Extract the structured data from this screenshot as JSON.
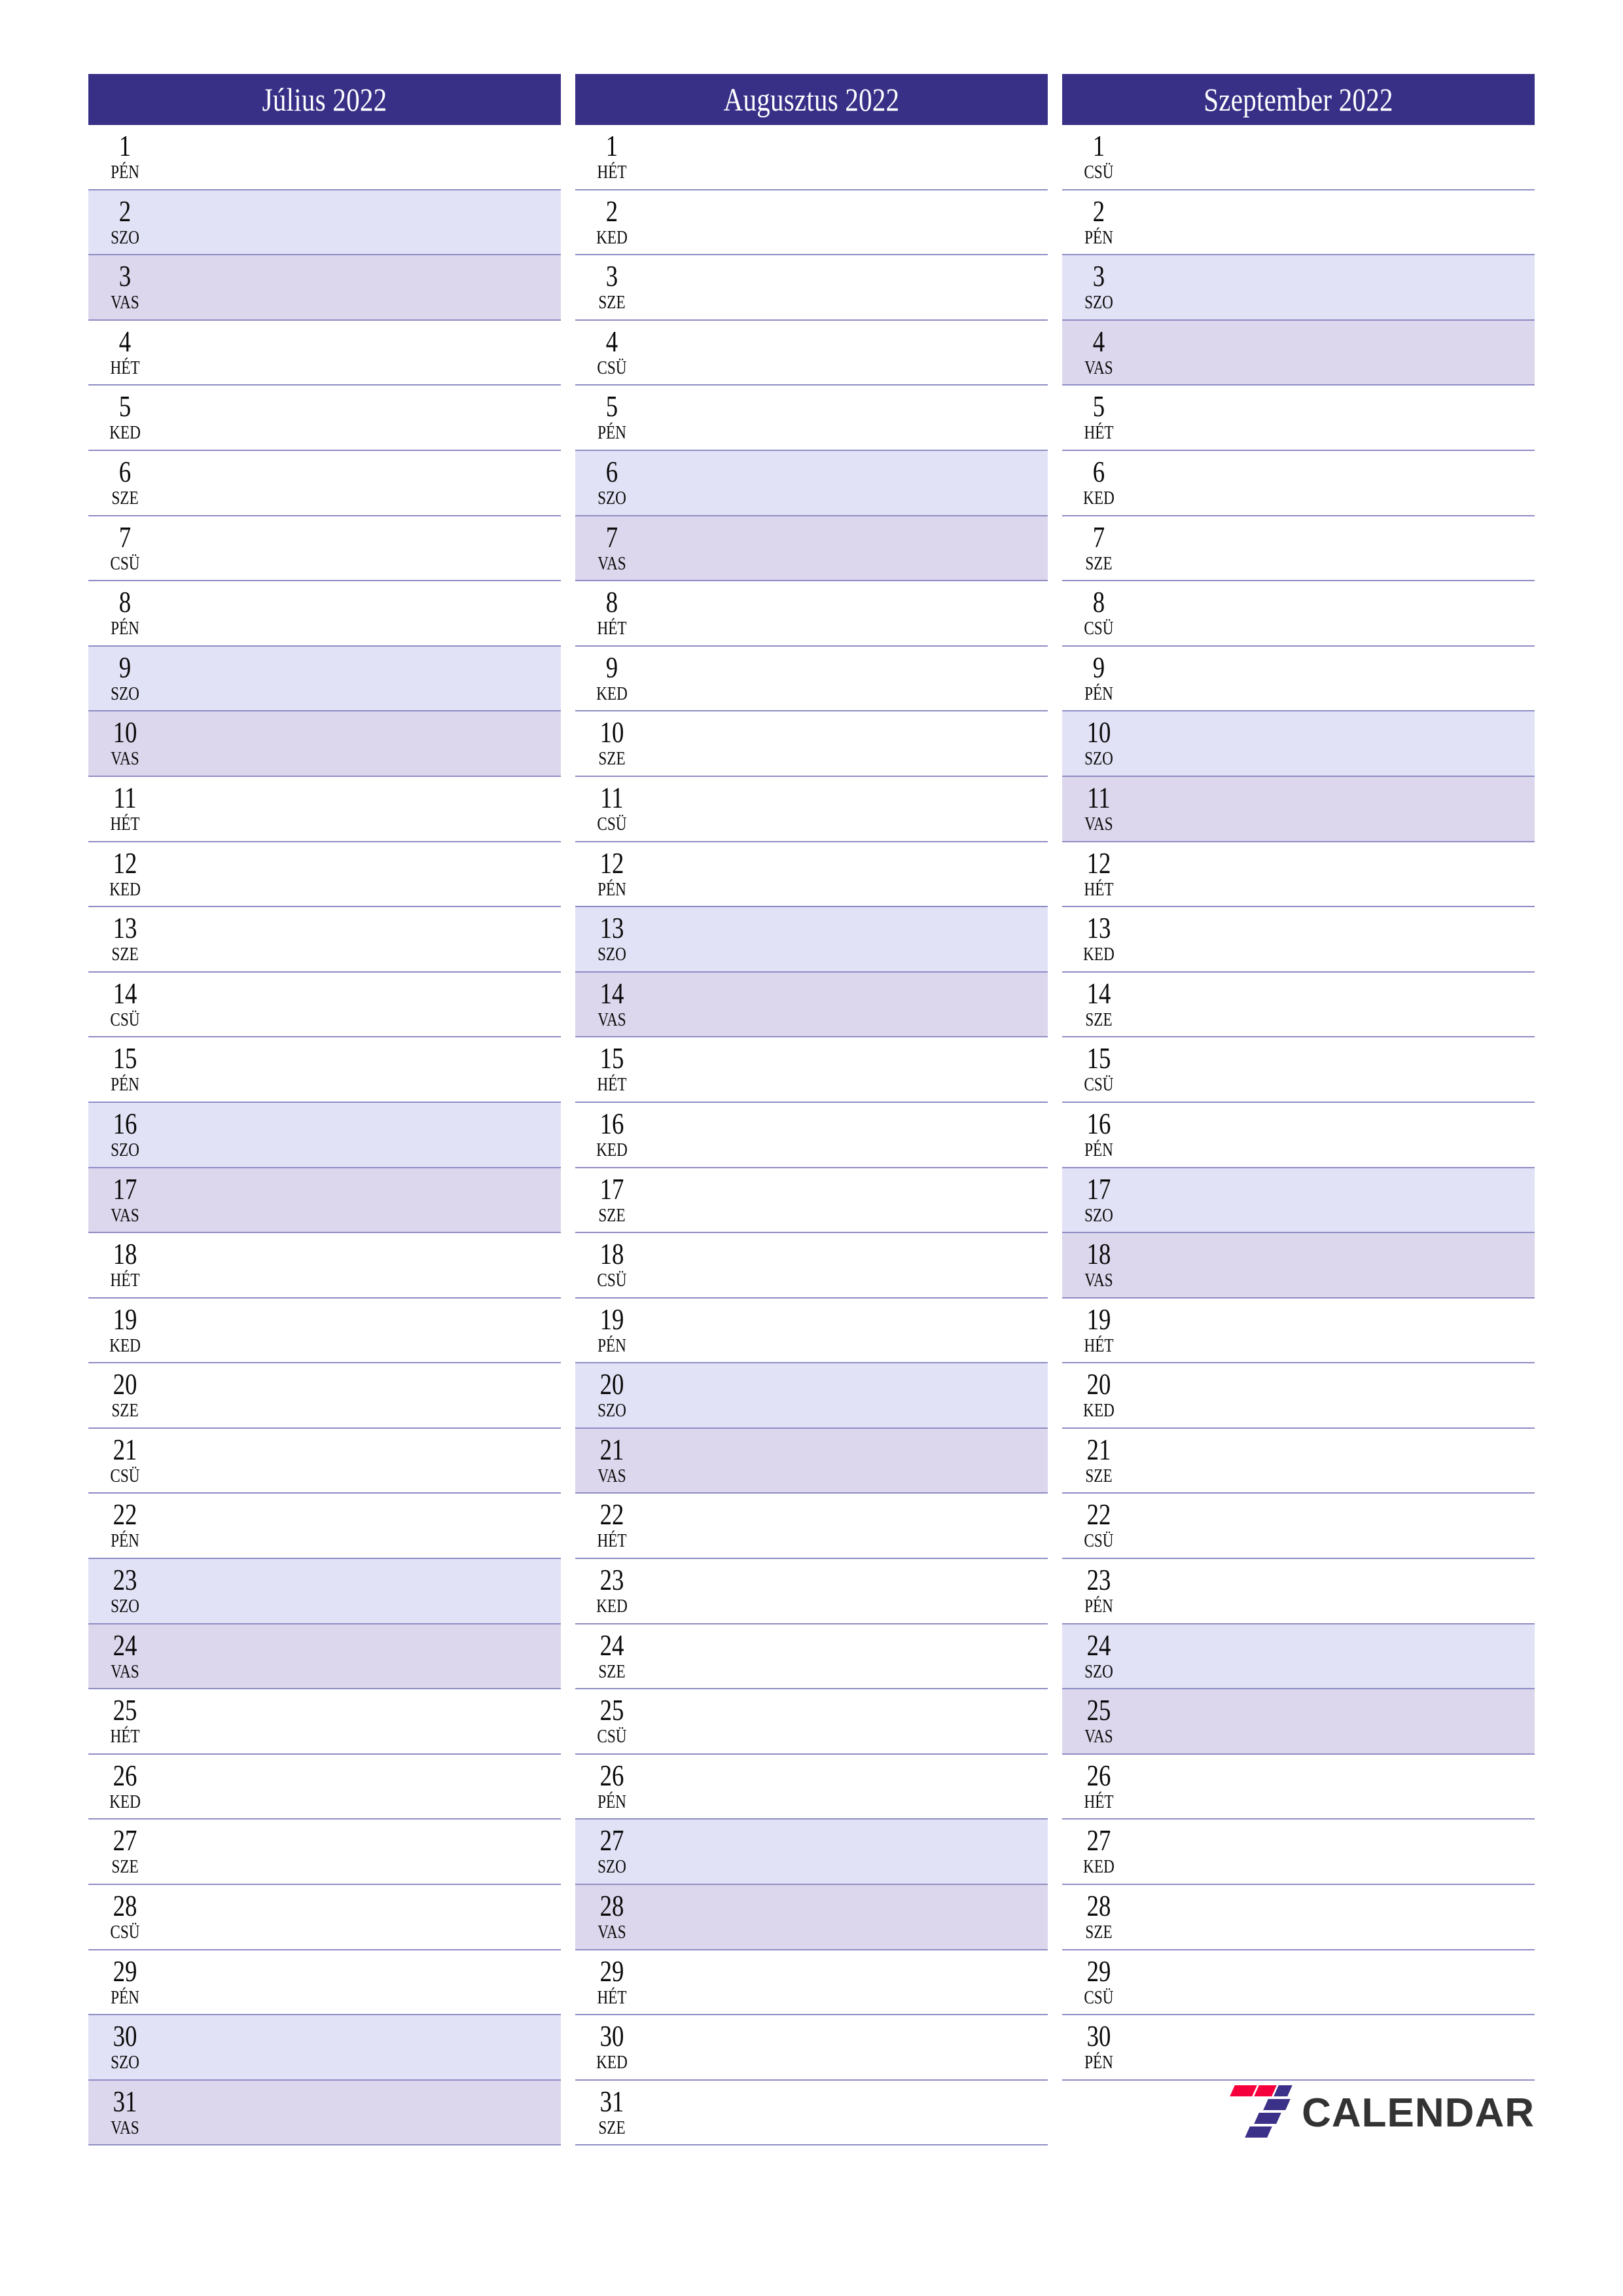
{
  "page": {
    "title": "Calendar 2022 Q3 (Hungarian)",
    "language": "hu",
    "colors": {
      "header_bg": "#383087",
      "header_text": "#ffffff",
      "saturday_bg": "#e2e2f6",
      "sunday_bg": "#dcd7ec",
      "row_border": "#8e8bc4",
      "day_text": "#0a0a0a",
      "logo_red": "#f5003c",
      "logo_purple": "#3b3189",
      "logo_text": "#333333"
    }
  },
  "brand": {
    "mark_name": "seven-logo-icon",
    "text": "CALENDAR"
  },
  "months": [
    {
      "name": "july",
      "title": "Július 2022",
      "days": [
        {
          "num": "1",
          "dow": "PÉN",
          "type": "weekday"
        },
        {
          "num": "2",
          "dow": "SZO",
          "type": "sat"
        },
        {
          "num": "3",
          "dow": "VAS",
          "type": "sun"
        },
        {
          "num": "4",
          "dow": "HÉT",
          "type": "weekday"
        },
        {
          "num": "5",
          "dow": "KED",
          "type": "weekday"
        },
        {
          "num": "6",
          "dow": "SZE",
          "type": "weekday"
        },
        {
          "num": "7",
          "dow": "CSÜ",
          "type": "weekday"
        },
        {
          "num": "8",
          "dow": "PÉN",
          "type": "weekday"
        },
        {
          "num": "9",
          "dow": "SZO",
          "type": "sat"
        },
        {
          "num": "10",
          "dow": "VAS",
          "type": "sun"
        },
        {
          "num": "11",
          "dow": "HÉT",
          "type": "weekday"
        },
        {
          "num": "12",
          "dow": "KED",
          "type": "weekday"
        },
        {
          "num": "13",
          "dow": "SZE",
          "type": "weekday"
        },
        {
          "num": "14",
          "dow": "CSÜ",
          "type": "weekday"
        },
        {
          "num": "15",
          "dow": "PÉN",
          "type": "weekday"
        },
        {
          "num": "16",
          "dow": "SZO",
          "type": "sat"
        },
        {
          "num": "17",
          "dow": "VAS",
          "type": "sun"
        },
        {
          "num": "18",
          "dow": "HÉT",
          "type": "weekday"
        },
        {
          "num": "19",
          "dow": "KED",
          "type": "weekday"
        },
        {
          "num": "20",
          "dow": "SZE",
          "type": "weekday"
        },
        {
          "num": "21",
          "dow": "CSÜ",
          "type": "weekday"
        },
        {
          "num": "22",
          "dow": "PÉN",
          "type": "weekday"
        },
        {
          "num": "23",
          "dow": "SZO",
          "type": "sat"
        },
        {
          "num": "24",
          "dow": "VAS",
          "type": "sun"
        },
        {
          "num": "25",
          "dow": "HÉT",
          "type": "weekday"
        },
        {
          "num": "26",
          "dow": "KED",
          "type": "weekday"
        },
        {
          "num": "27",
          "dow": "SZE",
          "type": "weekday"
        },
        {
          "num": "28",
          "dow": "CSÜ",
          "type": "weekday"
        },
        {
          "num": "29",
          "dow": "PÉN",
          "type": "weekday"
        },
        {
          "num": "30",
          "dow": "SZO",
          "type": "sat"
        },
        {
          "num": "31",
          "dow": "VAS",
          "type": "sun"
        }
      ]
    },
    {
      "name": "august",
      "title": "Augusztus 2022",
      "days": [
        {
          "num": "1",
          "dow": "HÉT",
          "type": "weekday"
        },
        {
          "num": "2",
          "dow": "KED",
          "type": "weekday"
        },
        {
          "num": "3",
          "dow": "SZE",
          "type": "weekday"
        },
        {
          "num": "4",
          "dow": "CSÜ",
          "type": "weekday"
        },
        {
          "num": "5",
          "dow": "PÉN",
          "type": "weekday"
        },
        {
          "num": "6",
          "dow": "SZO",
          "type": "sat"
        },
        {
          "num": "7",
          "dow": "VAS",
          "type": "sun"
        },
        {
          "num": "8",
          "dow": "HÉT",
          "type": "weekday"
        },
        {
          "num": "9",
          "dow": "KED",
          "type": "weekday"
        },
        {
          "num": "10",
          "dow": "SZE",
          "type": "weekday"
        },
        {
          "num": "11",
          "dow": "CSÜ",
          "type": "weekday"
        },
        {
          "num": "12",
          "dow": "PÉN",
          "type": "weekday"
        },
        {
          "num": "13",
          "dow": "SZO",
          "type": "sat"
        },
        {
          "num": "14",
          "dow": "VAS",
          "type": "sun"
        },
        {
          "num": "15",
          "dow": "HÉT",
          "type": "weekday"
        },
        {
          "num": "16",
          "dow": "KED",
          "type": "weekday"
        },
        {
          "num": "17",
          "dow": "SZE",
          "type": "weekday"
        },
        {
          "num": "18",
          "dow": "CSÜ",
          "type": "weekday"
        },
        {
          "num": "19",
          "dow": "PÉN",
          "type": "weekday"
        },
        {
          "num": "20",
          "dow": "SZO",
          "type": "sat"
        },
        {
          "num": "21",
          "dow": "VAS",
          "type": "sun"
        },
        {
          "num": "22",
          "dow": "HÉT",
          "type": "weekday"
        },
        {
          "num": "23",
          "dow": "KED",
          "type": "weekday"
        },
        {
          "num": "24",
          "dow": "SZE",
          "type": "weekday"
        },
        {
          "num": "25",
          "dow": "CSÜ",
          "type": "weekday"
        },
        {
          "num": "26",
          "dow": "PÉN",
          "type": "weekday"
        },
        {
          "num": "27",
          "dow": "SZO",
          "type": "sat"
        },
        {
          "num": "28",
          "dow": "VAS",
          "type": "sun"
        },
        {
          "num": "29",
          "dow": "HÉT",
          "type": "weekday"
        },
        {
          "num": "30",
          "dow": "KED",
          "type": "weekday"
        },
        {
          "num": "31",
          "dow": "SZE",
          "type": "weekday"
        }
      ]
    },
    {
      "name": "september",
      "title": "Szeptember 2022",
      "days": [
        {
          "num": "1",
          "dow": "CSÜ",
          "type": "weekday"
        },
        {
          "num": "2",
          "dow": "PÉN",
          "type": "weekday"
        },
        {
          "num": "3",
          "dow": "SZO",
          "type": "sat"
        },
        {
          "num": "4",
          "dow": "VAS",
          "type": "sun"
        },
        {
          "num": "5",
          "dow": "HÉT",
          "type": "weekday"
        },
        {
          "num": "6",
          "dow": "KED",
          "type": "weekday"
        },
        {
          "num": "7",
          "dow": "SZE",
          "type": "weekday"
        },
        {
          "num": "8",
          "dow": "CSÜ",
          "type": "weekday"
        },
        {
          "num": "9",
          "dow": "PÉN",
          "type": "weekday"
        },
        {
          "num": "10",
          "dow": "SZO",
          "type": "sat"
        },
        {
          "num": "11",
          "dow": "VAS",
          "type": "sun"
        },
        {
          "num": "12",
          "dow": "HÉT",
          "type": "weekday"
        },
        {
          "num": "13",
          "dow": "KED",
          "type": "weekday"
        },
        {
          "num": "14",
          "dow": "SZE",
          "type": "weekday"
        },
        {
          "num": "15",
          "dow": "CSÜ",
          "type": "weekday"
        },
        {
          "num": "16",
          "dow": "PÉN",
          "type": "weekday"
        },
        {
          "num": "17",
          "dow": "SZO",
          "type": "sat"
        },
        {
          "num": "18",
          "dow": "VAS",
          "type": "sun"
        },
        {
          "num": "19",
          "dow": "HÉT",
          "type": "weekday"
        },
        {
          "num": "20",
          "dow": "KED",
          "type": "weekday"
        },
        {
          "num": "21",
          "dow": "SZE",
          "type": "weekday"
        },
        {
          "num": "22",
          "dow": "CSÜ",
          "type": "weekday"
        },
        {
          "num": "23",
          "dow": "PÉN",
          "type": "weekday"
        },
        {
          "num": "24",
          "dow": "SZO",
          "type": "sat"
        },
        {
          "num": "25",
          "dow": "VAS",
          "type": "sun"
        },
        {
          "num": "26",
          "dow": "HÉT",
          "type": "weekday"
        },
        {
          "num": "27",
          "dow": "KED",
          "type": "weekday"
        },
        {
          "num": "28",
          "dow": "SZE",
          "type": "weekday"
        },
        {
          "num": "29",
          "dow": "CSÜ",
          "type": "weekday"
        },
        {
          "num": "30",
          "dow": "PÉN",
          "type": "weekday"
        },
        {
          "num": "",
          "dow": "",
          "type": "blank"
        }
      ]
    }
  ]
}
